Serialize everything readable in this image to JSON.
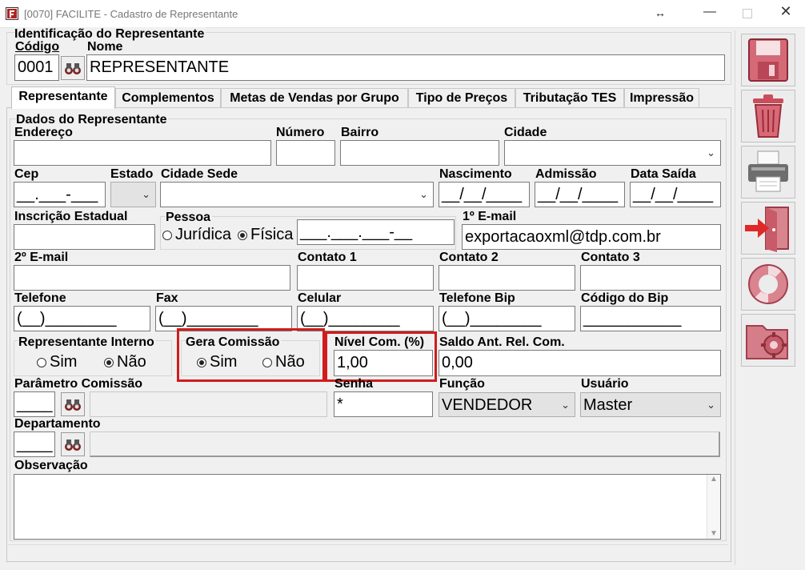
{
  "window": {
    "title": "[0070] FACILITE - Cadastro de Representante"
  },
  "header": {
    "section_title": "Identificação do Representante",
    "codigo_label": "Código",
    "codigo_value": "0001",
    "nome_label": "Nome",
    "nome_value": "REPRESENTANTE"
  },
  "tabs": [
    {
      "label": "Representante"
    },
    {
      "label": "Complementos"
    },
    {
      "label": "Metas de Vendas por Grupo"
    },
    {
      "label": "Tipo de Preços"
    },
    {
      "label": "Tributação TES"
    },
    {
      "label": "Impressão"
    }
  ],
  "form": {
    "group_title": "Dados do Representante",
    "endereco_label": "Endereço",
    "numero_label": "Número",
    "bairro_label": "Bairro",
    "cidade_label": "Cidade",
    "cep_label": "Cep",
    "cep_value": "__.___-___",
    "estado_label": "Estado",
    "cidade_sede_label": "Cidade Sede",
    "nascimento_label": "Nascimento",
    "nascimento_value": "__/__/____",
    "admissao_label": "Admissão",
    "admissao_value": "__/__/____",
    "data_saida_label": "Data Saída",
    "data_saida_value": "__/__/____",
    "inscricao_label": "Inscrição Estadual",
    "pessoa_label": "Pessoa",
    "pessoa_juridica": "Jurídica",
    "pessoa_fisica": "Física",
    "cpf_value": "___.___.___-__",
    "email1_label": "1º E-mail",
    "email1_value": "exportacaoxml@tdp.com.br",
    "email2_label": "2º E-mail",
    "contato1_label": "Contato 1",
    "contato2_label": "Contato 2",
    "contato3_label": "Contato 3",
    "telefone_label": "Telefone",
    "telefone_value": "(__)________",
    "fax_label": "Fax",
    "fax_value": "(__)________",
    "celular_label": "Celular",
    "celular_value": "(__)________",
    "telefone_bip_label": "Telefone Bip",
    "telefone_bip_value": "(__)________",
    "codigo_bip_label": "Código do Bip",
    "codigo_bip_value": "___________",
    "rep_interno_label": "Representante Interno",
    "rep_interno_sim": "Sim",
    "rep_interno_nao": "Não",
    "gera_comissao_label": "Gera Comissão",
    "gera_comissao_sim": "Sim",
    "gera_comissao_nao": "Não",
    "nivel_com_label": "Nível Com. (%)",
    "nivel_com_value": "1,00",
    "saldo_label": "Saldo Ant. Rel. Com.",
    "saldo_value": "0,00",
    "parametro_label": "Parâmetro Comissão",
    "parametro_value": "____",
    "senha_label": "Senha",
    "senha_value": "*",
    "funcao_label": "Função",
    "funcao_value": "VENDEDOR",
    "usuario_label": "Usuário",
    "usuario_value": "Master",
    "departamento_label": "Departamento",
    "departamento_value": "____",
    "observacao_label": "Observação"
  },
  "colors": {
    "highlight": "#d01c1c",
    "toolbar_icon": "#c74b5a"
  },
  "toolbar_icons": [
    "save-icon",
    "delete-icon",
    "print-icon",
    "exit-icon",
    "help-icon",
    "settings-icon"
  ]
}
